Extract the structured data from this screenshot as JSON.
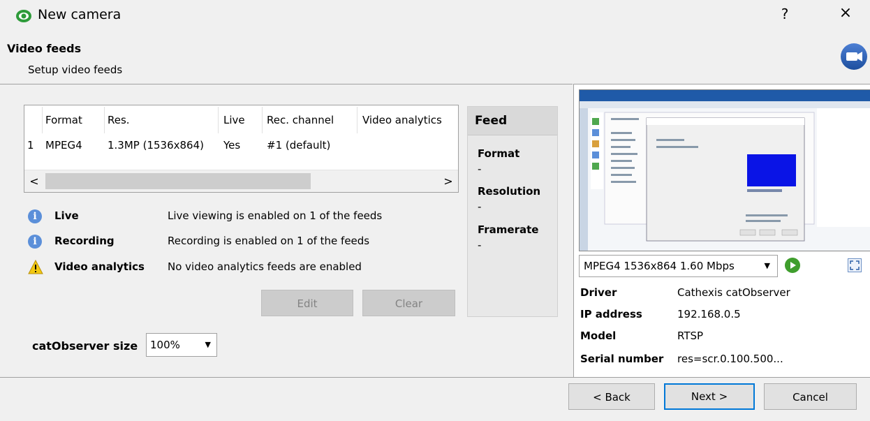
{
  "window": {
    "title": "New camera",
    "help_symbol": "?",
    "close_symbol": "×",
    "app_icon": "eye-icon"
  },
  "header": {
    "heading": "Video feeds",
    "subheading": "Setup video feeds",
    "badge_icon": "camera-icon"
  },
  "feeds_table": {
    "columns": [
      "",
      "Format",
      "Res.",
      "Live",
      "Rec. channel",
      "Video analytics"
    ],
    "rows": [
      {
        "index": "1",
        "format": "MPEG4",
        "res": "1.3MP (1536x864)",
        "live": "Yes",
        "rec_channel": "#1 (default)",
        "video_analytics": ""
      }
    ],
    "scroll_left": "<",
    "scroll_right": ">"
  },
  "status": [
    {
      "icon": "info-icon",
      "label": "Live",
      "text": "Live viewing is enabled on 1 of the feeds"
    },
    {
      "icon": "info-icon",
      "label": "Recording",
      "text": "Recording is enabled on 1 of the feeds"
    },
    {
      "icon": "warning-icon",
      "label": "Video analytics",
      "text": "No video analytics feeds are enabled"
    }
  ],
  "buttons": {
    "edit": "Edit",
    "clear": "Clear",
    "back": "< Back",
    "next": "Next >",
    "cancel": "Cancel"
  },
  "size": {
    "label": "catObserver size",
    "value": "100%"
  },
  "feed_panel": {
    "title": "Feed",
    "format_label": "Format",
    "format_value": "-",
    "resolution_label": "Resolution",
    "resolution_value": "-",
    "framerate_label": "Framerate",
    "framerate_value": "-"
  },
  "stream": {
    "selected": "MPEG4 1536x864 1.60 Mbps"
  },
  "camera_info": [
    {
      "key": "Driver",
      "value": "Cathexis catObserver"
    },
    {
      "key": "IP address",
      "value": "192.168.0.5"
    },
    {
      "key": "Model",
      "value": "RTSP"
    },
    {
      "key": "Serial number",
      "value": "res=scr.0.100.500..."
    }
  ],
  "colors": {
    "accent": "#0078d7",
    "play_green": "#3f9e2d",
    "info_blue": "#5b8fd9",
    "warning_yellow": "#f2c811"
  }
}
